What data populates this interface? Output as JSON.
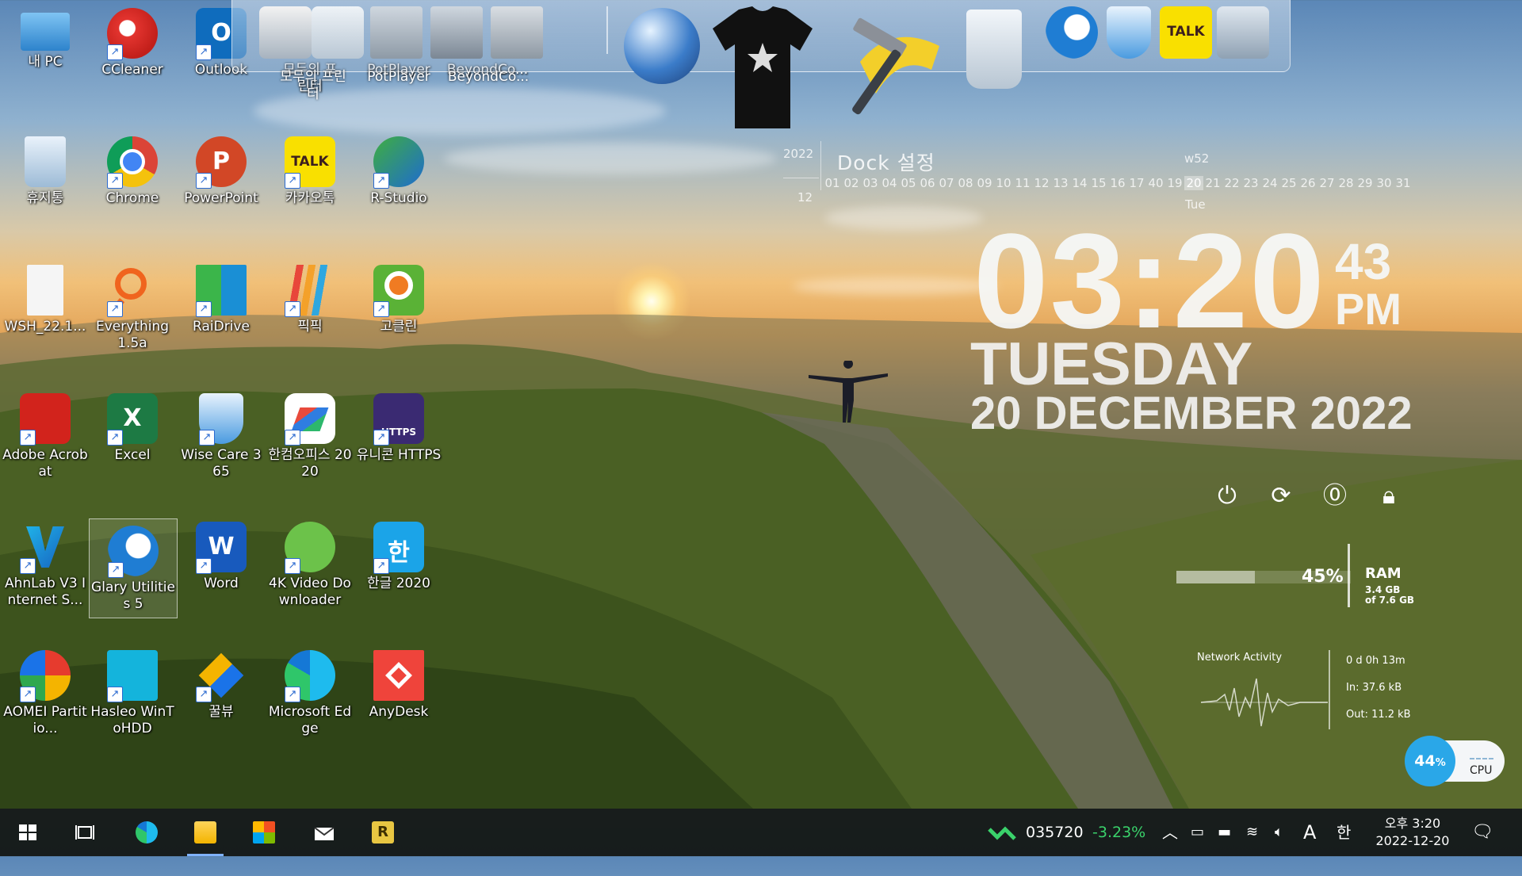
{
  "desktop": {
    "icons": [
      {
        "label": "내 PC"
      },
      {
        "label": "CCleaner"
      },
      {
        "label": "Outlook"
      },
      {
        "label": "모두의 프린터"
      },
      {
        "label": "PotPlayer"
      },
      {
        "label": "BeyondCo..."
      },
      {
        "label": "휴지통"
      },
      {
        "label": "Chrome"
      },
      {
        "label": "PowerPoint"
      },
      {
        "label": "카카오톡"
      },
      {
        "label": "R-Studio"
      },
      {
        "label": "WSH_22.1..."
      },
      {
        "label": "Everything 1.5a"
      },
      {
        "label": "RaiDrive"
      },
      {
        "label": "픽픽"
      },
      {
        "label": "고클린"
      },
      {
        "label": "Adobe Acrobat"
      },
      {
        "label": "Excel"
      },
      {
        "label": "Wise Care 365"
      },
      {
        "label": "한컴오피스 2020"
      },
      {
        "label": "유니콘 HTTPS"
      },
      {
        "label": "AhnLab V3 Internet S..."
      },
      {
        "label": "Glary Utilities 5"
      },
      {
        "label": "Word"
      },
      {
        "label": "4K Video Downloader"
      },
      {
        "label": "한글 2020"
      },
      {
        "label": "AOMEI Partitio..."
      },
      {
        "label": "Hasleo WinToHDD"
      },
      {
        "label": "꿀뷰"
      },
      {
        "label": "Microsoft Edge"
      },
      {
        "label": "AnyDesk"
      }
    ],
    "icon_glyphs": {
      "outlook": "O",
      "powerpoint": "P",
      "kakao": "TALK",
      "excel": "X",
      "word": "W",
      "https": "HTTPS",
      "hangul": "한"
    }
  },
  "dock": {
    "title": "Dock 설정",
    "colors": {
      "dock_bg": "#c8d6e4",
      "talk_yellow": "#f9e000"
    }
  },
  "calendar": {
    "year": "2022",
    "month": "12",
    "week": "w52",
    "weekday_short": "Tue",
    "days": [
      "01",
      "02",
      "03",
      "04",
      "05",
      "06",
      "07",
      "08",
      "09",
      "10",
      "11",
      "12",
      "13",
      "14",
      "15",
      "16",
      "17",
      "40",
      "19",
      "20",
      "21",
      "22",
      "23",
      "24",
      "25",
      "26",
      "27",
      "28",
      "29",
      "30",
      "31"
    ],
    "today": "20"
  },
  "clock": {
    "hours_minutes": "03:20",
    "seconds": "43",
    "ampm": "PM",
    "weekday": "TUESDAY",
    "date_line": "20 DECEMBER  2022"
  },
  "system": {
    "ram_percent": "45%",
    "ram_fraction": 0.45,
    "ram_label": "RAM",
    "ram_used": "3.4 GB",
    "ram_total": "of 7.6 GB",
    "network_title": "Network Activity",
    "uptime": "0 d 0h 13m",
    "net_in": "In: 37.6 kB",
    "net_out": "Out: 11.2 kB",
    "cpu_percent": "44",
    "cpu_unit": "%",
    "cpu_label": "CPU"
  },
  "taskbar": {
    "stock_code": "035720",
    "stock_change": "-3.23%",
    "ime_letter": "A",
    "ime_lang": "한",
    "time": "오후 3:20",
    "date": "2022-12-20",
    "colors": {
      "taskbar": "#14181c",
      "accent": "#7fb2ff",
      "stock_down": "#3ad26b"
    }
  }
}
